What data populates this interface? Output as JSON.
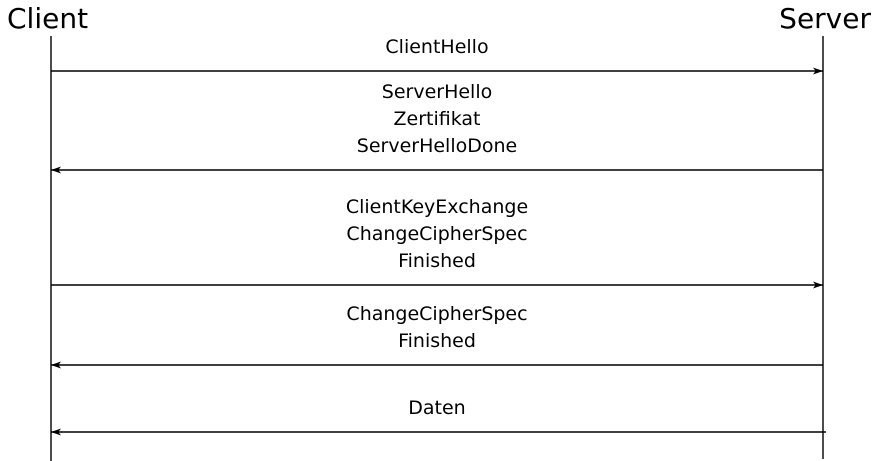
{
  "actors": {
    "client": "Client",
    "server": "Server"
  },
  "messages": [
    {
      "direction": "client-to-server",
      "lines": [
        "ClientHello"
      ]
    },
    {
      "direction": "server-to-client",
      "lines": [
        "ServerHello",
        "Zertifikat",
        "ServerHelloDone"
      ]
    },
    {
      "direction": "client-to-server",
      "lines": [
        "ClientKeyExchange",
        "ChangeCipherSpec",
        "Finished"
      ]
    },
    {
      "direction": "server-to-client",
      "lines": [
        "ChangeCipherSpec",
        "Finished"
      ]
    },
    {
      "direction": "server-to-client",
      "lines": [
        "Daten"
      ]
    }
  ]
}
